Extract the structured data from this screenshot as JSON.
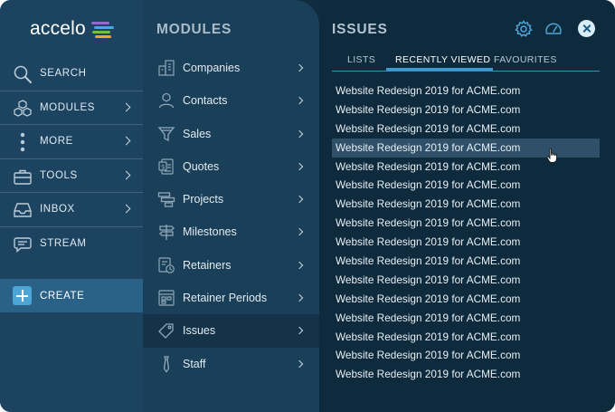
{
  "brand": {
    "name": "accelo",
    "mark_colors": [
      "#f5a623",
      "#6cc04a",
      "#3fa9f5",
      "#9b59b6"
    ]
  },
  "nav": {
    "items": [
      {
        "label": "SEARCH",
        "icon": "search-icon",
        "chevron": false
      },
      {
        "label": "MODULES",
        "icon": "cubes-icon",
        "chevron": true
      },
      {
        "label": "MORE",
        "icon": "more-dots-icon",
        "chevron": true
      },
      {
        "label": "TOOLS",
        "icon": "toolbox-icon",
        "chevron": true
      },
      {
        "label": "INBOX",
        "icon": "inbox-icon",
        "chevron": true
      },
      {
        "label": "STREAM",
        "icon": "chat-bubble-icon",
        "chevron": false
      }
    ],
    "create_label": "CREATE"
  },
  "modules": {
    "title": "MODULES",
    "items": [
      {
        "label": "Companies",
        "icon": "building-icon"
      },
      {
        "label": "Contacts",
        "icon": "person-icon"
      },
      {
        "label": "Sales",
        "icon": "funnel-icon"
      },
      {
        "label": "Quotes",
        "icon": "quote-document-icon"
      },
      {
        "label": "Projects",
        "icon": "gantt-icon"
      },
      {
        "label": "Milestones",
        "icon": "signpost-icon"
      },
      {
        "label": "Retainers",
        "icon": "retainer-icon"
      },
      {
        "label": "Retainer Periods",
        "icon": "retainer-periods-icon"
      },
      {
        "label": "Issues",
        "icon": "tag-icon",
        "active": true
      },
      {
        "label": "Staff",
        "icon": "tie-icon"
      }
    ]
  },
  "issues": {
    "title": "ISSUES",
    "tabs": [
      {
        "label": "LISTS"
      },
      {
        "label": "RECENTLY VIEWED",
        "active": true
      },
      {
        "label": "FAVOURITES"
      }
    ],
    "items": [
      "Website Redesign 2019 for ACME.com",
      "Website Redesign 2019 for ACME.com",
      "Website Redesign 2019 for ACME.com",
      "Website Redesign 2019 for ACME.com",
      "Website Redesign 2019 for ACME.com",
      "Website Redesign 2019 for ACME.com",
      "Website Redesign 2019 for ACME.com",
      "Website Redesign 2019 for ACME.com",
      "Website Redesign 2019 for ACME.com",
      "Website Redesign 2019 for ACME.com",
      "Website Redesign 2019 for ACME.com",
      "Website Redesign 2019 for ACME.com",
      "Website Redesign 2019 for ACME.com",
      "Website Redesign 2019 for ACME.com",
      "Website Redesign 2019 for ACME.com",
      "Website Redesign 2019 for ACME.com"
    ],
    "hovered_index": 3,
    "header_icons": [
      "gear-icon",
      "dashboard-gauge-icon",
      "close-icon"
    ]
  },
  "colors": {
    "accent": "#3d9bd0",
    "nav_bg": "#1c4460",
    "panel_bg": "#0e2a3d"
  }
}
